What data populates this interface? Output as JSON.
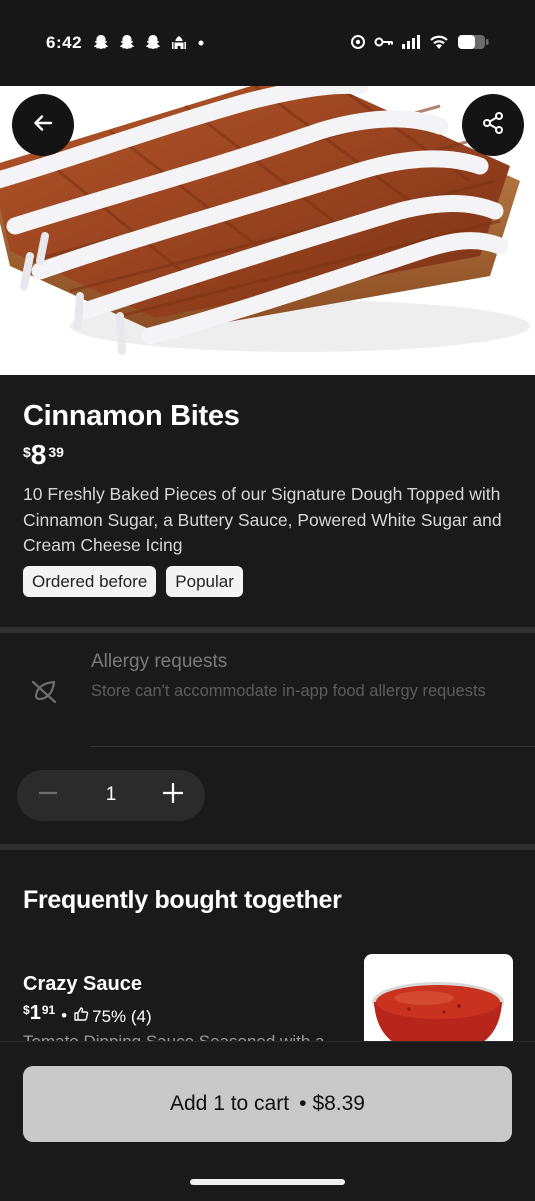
{
  "status_bar": {
    "time": "6:42",
    "left_icons": [
      "snapchat-icon",
      "snapchat-icon",
      "snapchat-icon",
      "mosque-icon",
      "dot-icon"
    ],
    "right_icons": [
      "location-target-icon",
      "key-icon",
      "signal-icon",
      "wifi-icon",
      "battery-icon"
    ]
  },
  "header": {
    "back_icon": "arrow-left-icon",
    "share_icon": "share-icon"
  },
  "item": {
    "title": "Cinnamon Bites",
    "price_currency": "$",
    "price_dollars": "8",
    "price_cents": "39",
    "description": "10 Freshly Baked Pieces of our Signature Dough Topped with Cinnamon Sugar, a Buttery Sauce, Powered White Sugar and Cream Cheese Icing",
    "badges": [
      "Ordered before",
      "Popular"
    ]
  },
  "allergy": {
    "icon": "leaf-slash-icon",
    "title": "Allergy requests",
    "subtitle": "Store can't accommodate in-app food allergy requests"
  },
  "quantity": {
    "value": "1"
  },
  "frequently_bought": {
    "title": "Frequently bought together",
    "items": [
      {
        "name": "Crazy Sauce",
        "price_currency": "$",
        "price_dollars": "1",
        "price_cents": "91",
        "rating": "75% (4)",
        "description": "Tomato Dipping Sauce Seasoned with a"
      }
    ]
  },
  "cart": {
    "label": "Add 1 to cart",
    "separator": "•",
    "total": "$8.39"
  },
  "colors": {
    "background": "#1a1a1a",
    "button": "#c9c9c9",
    "badge": "#f3f3f3"
  }
}
